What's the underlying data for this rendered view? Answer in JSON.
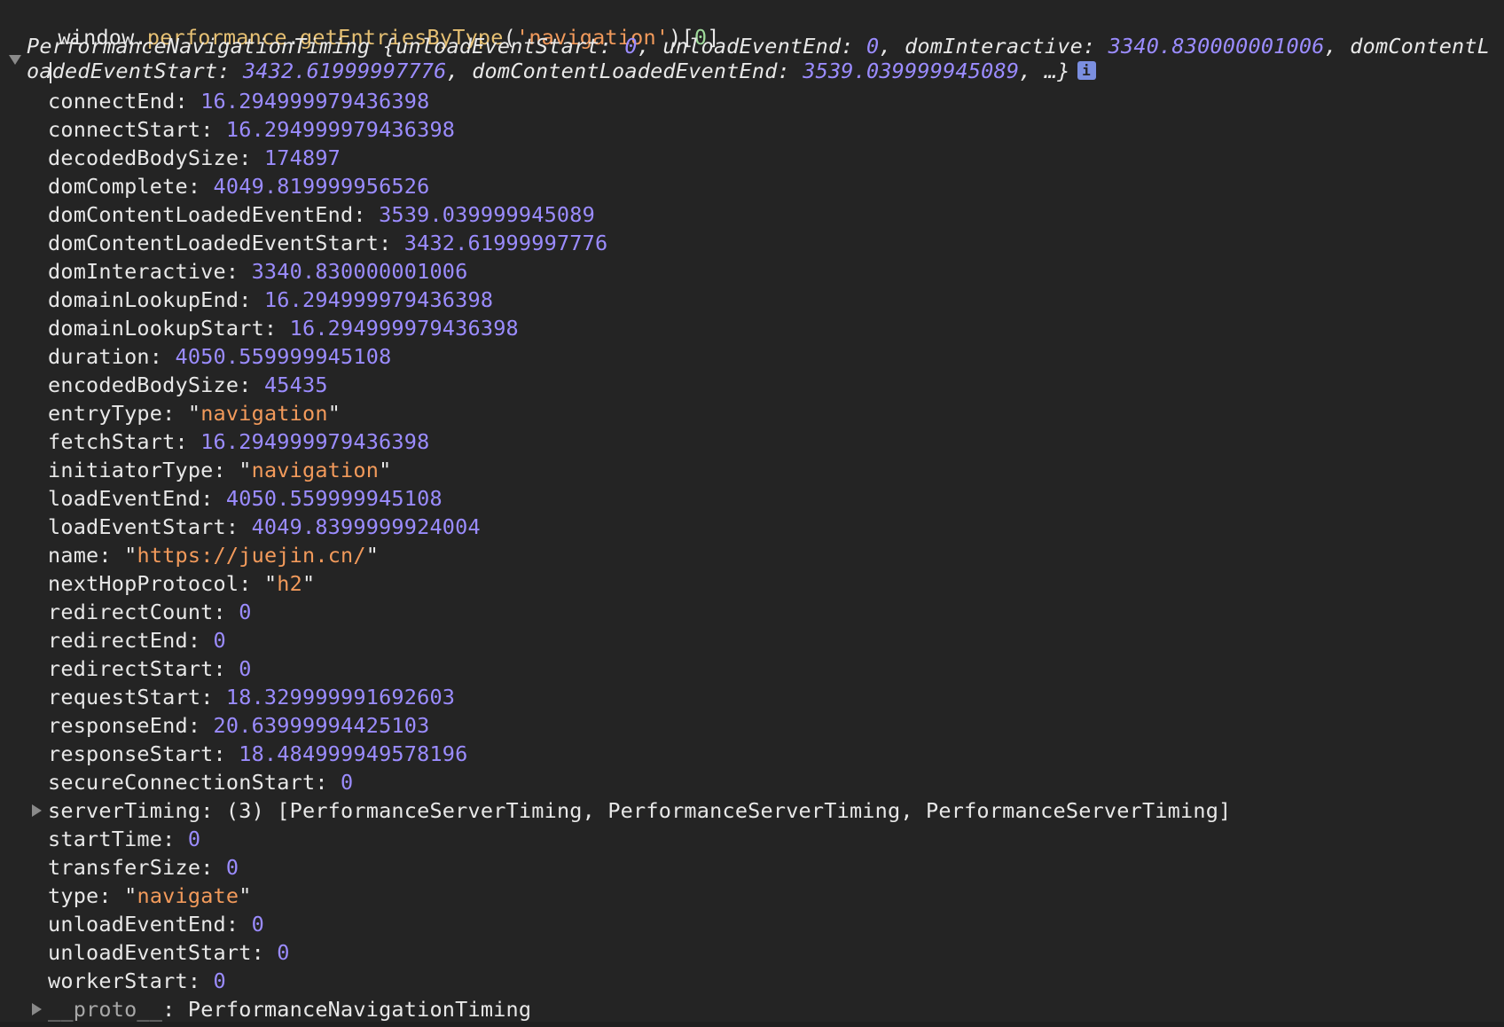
{
  "command": {
    "object": "window.",
    "prop1": "performance",
    "dot": ".",
    "prop2": "getEntriesByType",
    "open": "(",
    "arg": "'navigation'",
    "close": ")[",
    "index": "0",
    "end": "]"
  },
  "summary": {
    "class_name": "PerformanceNavigationTiming",
    "line1": [
      {
        "t": "PerformanceNavigationTiming {unloadEventStart: ",
        "c": "k"
      },
      {
        "t": "0",
        "c": "v"
      },
      {
        "t": ", unloadEventEnd: ",
        "c": "k"
      },
      {
        "t": "0",
        "c": "v"
      },
      {
        "t": ", domInteractive: ",
        "c": "k"
      },
      {
        "t": "3340.830000001006",
        "c": "v"
      },
      {
        "t": ", domContentL",
        "c": "k"
      }
    ],
    "line2": [
      {
        "t": "oadedEventStart: ",
        "c": "k"
      },
      {
        "t": "3432.61999997776",
        "c": "v"
      },
      {
        "t": ", domContentLoadedEventEnd: ",
        "c": "k"
      },
      {
        "t": "3539.039999945089",
        "c": "v"
      },
      {
        "t": ", …}",
        "c": "k"
      }
    ],
    "info_icon": "info-icon"
  },
  "properties": [
    {
      "key": "connectEnd",
      "type": "num",
      "value": "16.294999979436398"
    },
    {
      "key": "connectStart",
      "type": "num",
      "value": "16.294999979436398"
    },
    {
      "key": "decodedBodySize",
      "type": "num",
      "value": "174897"
    },
    {
      "key": "domComplete",
      "type": "num",
      "value": "4049.819999956526"
    },
    {
      "key": "domContentLoadedEventEnd",
      "type": "num",
      "value": "3539.039999945089"
    },
    {
      "key": "domContentLoadedEventStart",
      "type": "num",
      "value": "3432.61999997776"
    },
    {
      "key": "domInteractive",
      "type": "num",
      "value": "3340.830000001006"
    },
    {
      "key": "domainLookupEnd",
      "type": "num",
      "value": "16.294999979436398"
    },
    {
      "key": "domainLookupStart",
      "type": "num",
      "value": "16.294999979436398"
    },
    {
      "key": "duration",
      "type": "num",
      "value": "4050.559999945108"
    },
    {
      "key": "encodedBodySize",
      "type": "num",
      "value": "45435"
    },
    {
      "key": "entryType",
      "type": "str",
      "value": "navigation"
    },
    {
      "key": "fetchStart",
      "type": "num",
      "value": "16.294999979436398"
    },
    {
      "key": "initiatorType",
      "type": "str",
      "value": "navigation"
    },
    {
      "key": "loadEventEnd",
      "type": "num",
      "value": "4050.559999945108"
    },
    {
      "key": "loadEventStart",
      "type": "num",
      "value": "4049.8399999924004"
    },
    {
      "key": "name",
      "type": "str",
      "value": "https://juejin.cn/"
    },
    {
      "key": "nextHopProtocol",
      "type": "str",
      "value": "h2"
    },
    {
      "key": "redirectCount",
      "type": "num",
      "value": "0"
    },
    {
      "key": "redirectEnd",
      "type": "num",
      "value": "0"
    },
    {
      "key": "redirectStart",
      "type": "num",
      "value": "0"
    },
    {
      "key": "requestStart",
      "type": "num",
      "value": "18.329999991692603"
    },
    {
      "key": "responseEnd",
      "type": "num",
      "value": "20.63999994425103"
    },
    {
      "key": "responseStart",
      "type": "num",
      "value": "18.484999949578196"
    },
    {
      "key": "secureConnectionStart",
      "type": "num",
      "value": "0"
    },
    {
      "key": "serverTiming",
      "type": "plain",
      "value": "(3) [PerformanceServerTiming, PerformanceServerTiming, PerformanceServerTiming]",
      "expandable": true
    },
    {
      "key": "startTime",
      "type": "num",
      "value": "0"
    },
    {
      "key": "transferSize",
      "type": "num",
      "value": "0"
    },
    {
      "key": "type",
      "type": "str",
      "value": "navigate"
    },
    {
      "key": "unloadEventEnd",
      "type": "num",
      "value": "0"
    },
    {
      "key": "unloadEventStart",
      "type": "num",
      "value": "0"
    },
    {
      "key": "workerStart",
      "type": "num",
      "value": "0"
    },
    {
      "key": "__proto__",
      "type": "plain",
      "value": "PerformanceNavigationTiming",
      "expandable": true,
      "proto": true
    }
  ],
  "colors": {
    "background": "#242424",
    "number": "#9b8cff",
    "string": "#f29a5b",
    "property_call": "#e6c073",
    "index": "#9fda9a",
    "text": "#e8e8e8"
  }
}
